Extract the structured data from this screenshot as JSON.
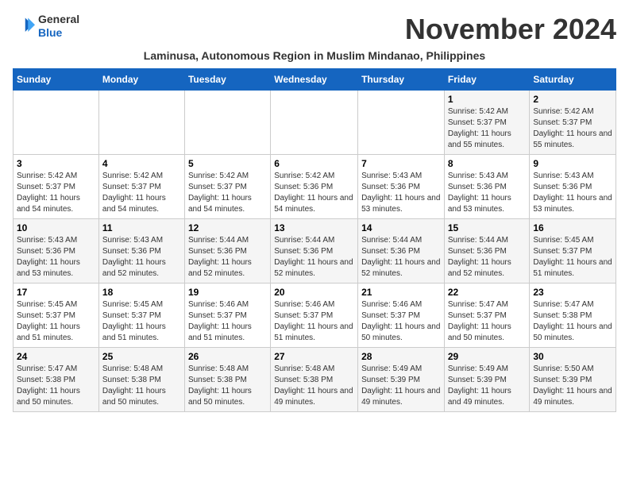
{
  "header": {
    "logo_line1": "General",
    "logo_line2": "Blue",
    "month": "November 2024",
    "subtitle": "Laminusa, Autonomous Region in Muslim Mindanao, Philippines"
  },
  "weekdays": [
    "Sunday",
    "Monday",
    "Tuesday",
    "Wednesday",
    "Thursday",
    "Friday",
    "Saturday"
  ],
  "weeks": [
    [
      {
        "day": "",
        "info": ""
      },
      {
        "day": "",
        "info": ""
      },
      {
        "day": "",
        "info": ""
      },
      {
        "day": "",
        "info": ""
      },
      {
        "day": "",
        "info": ""
      },
      {
        "day": "1",
        "info": "Sunrise: 5:42 AM\nSunset: 5:37 PM\nDaylight: 11 hours and 55 minutes."
      },
      {
        "day": "2",
        "info": "Sunrise: 5:42 AM\nSunset: 5:37 PM\nDaylight: 11 hours and 55 minutes."
      }
    ],
    [
      {
        "day": "3",
        "info": "Sunrise: 5:42 AM\nSunset: 5:37 PM\nDaylight: 11 hours and 54 minutes."
      },
      {
        "day": "4",
        "info": "Sunrise: 5:42 AM\nSunset: 5:37 PM\nDaylight: 11 hours and 54 minutes."
      },
      {
        "day": "5",
        "info": "Sunrise: 5:42 AM\nSunset: 5:37 PM\nDaylight: 11 hours and 54 minutes."
      },
      {
        "day": "6",
        "info": "Sunrise: 5:42 AM\nSunset: 5:36 PM\nDaylight: 11 hours and 54 minutes."
      },
      {
        "day": "7",
        "info": "Sunrise: 5:43 AM\nSunset: 5:36 PM\nDaylight: 11 hours and 53 minutes."
      },
      {
        "day": "8",
        "info": "Sunrise: 5:43 AM\nSunset: 5:36 PM\nDaylight: 11 hours and 53 minutes."
      },
      {
        "day": "9",
        "info": "Sunrise: 5:43 AM\nSunset: 5:36 PM\nDaylight: 11 hours and 53 minutes."
      }
    ],
    [
      {
        "day": "10",
        "info": "Sunrise: 5:43 AM\nSunset: 5:36 PM\nDaylight: 11 hours and 53 minutes."
      },
      {
        "day": "11",
        "info": "Sunrise: 5:43 AM\nSunset: 5:36 PM\nDaylight: 11 hours and 52 minutes."
      },
      {
        "day": "12",
        "info": "Sunrise: 5:44 AM\nSunset: 5:36 PM\nDaylight: 11 hours and 52 minutes."
      },
      {
        "day": "13",
        "info": "Sunrise: 5:44 AM\nSunset: 5:36 PM\nDaylight: 11 hours and 52 minutes."
      },
      {
        "day": "14",
        "info": "Sunrise: 5:44 AM\nSunset: 5:36 PM\nDaylight: 11 hours and 52 minutes."
      },
      {
        "day": "15",
        "info": "Sunrise: 5:44 AM\nSunset: 5:36 PM\nDaylight: 11 hours and 52 minutes."
      },
      {
        "day": "16",
        "info": "Sunrise: 5:45 AM\nSunset: 5:37 PM\nDaylight: 11 hours and 51 minutes."
      }
    ],
    [
      {
        "day": "17",
        "info": "Sunrise: 5:45 AM\nSunset: 5:37 PM\nDaylight: 11 hours and 51 minutes."
      },
      {
        "day": "18",
        "info": "Sunrise: 5:45 AM\nSunset: 5:37 PM\nDaylight: 11 hours and 51 minutes."
      },
      {
        "day": "19",
        "info": "Sunrise: 5:46 AM\nSunset: 5:37 PM\nDaylight: 11 hours and 51 minutes."
      },
      {
        "day": "20",
        "info": "Sunrise: 5:46 AM\nSunset: 5:37 PM\nDaylight: 11 hours and 51 minutes."
      },
      {
        "day": "21",
        "info": "Sunrise: 5:46 AM\nSunset: 5:37 PM\nDaylight: 11 hours and 50 minutes."
      },
      {
        "day": "22",
        "info": "Sunrise: 5:47 AM\nSunset: 5:37 PM\nDaylight: 11 hours and 50 minutes."
      },
      {
        "day": "23",
        "info": "Sunrise: 5:47 AM\nSunset: 5:38 PM\nDaylight: 11 hours and 50 minutes."
      }
    ],
    [
      {
        "day": "24",
        "info": "Sunrise: 5:47 AM\nSunset: 5:38 PM\nDaylight: 11 hours and 50 minutes."
      },
      {
        "day": "25",
        "info": "Sunrise: 5:48 AM\nSunset: 5:38 PM\nDaylight: 11 hours and 50 minutes."
      },
      {
        "day": "26",
        "info": "Sunrise: 5:48 AM\nSunset: 5:38 PM\nDaylight: 11 hours and 50 minutes."
      },
      {
        "day": "27",
        "info": "Sunrise: 5:48 AM\nSunset: 5:38 PM\nDaylight: 11 hours and 49 minutes."
      },
      {
        "day": "28",
        "info": "Sunrise: 5:49 AM\nSunset: 5:39 PM\nDaylight: 11 hours and 49 minutes."
      },
      {
        "day": "29",
        "info": "Sunrise: 5:49 AM\nSunset: 5:39 PM\nDaylight: 11 hours and 49 minutes."
      },
      {
        "day": "30",
        "info": "Sunrise: 5:50 AM\nSunset: 5:39 PM\nDaylight: 11 hours and 49 minutes."
      }
    ]
  ]
}
